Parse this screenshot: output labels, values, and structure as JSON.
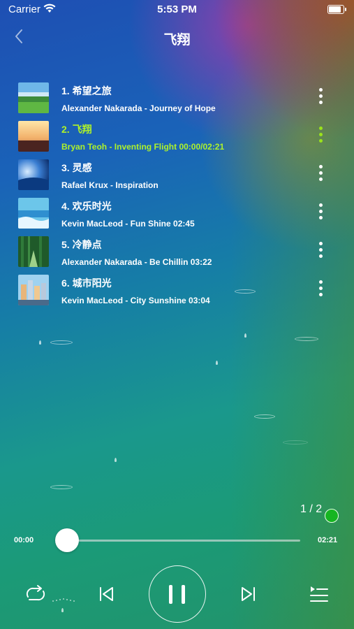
{
  "status_bar": {
    "carrier": "Carrier",
    "time": "5:53 PM",
    "battery_level": 0.95
  },
  "nav": {
    "title": "飞翔",
    "back_icon": "chevron-left-icon"
  },
  "tracks": [
    {
      "title": "1. 希望之旅",
      "subtitle": "Alexander Nakarada - Journey of Hope",
      "active": false
    },
    {
      "title": "2. 飞翔",
      "subtitle": "Bryan Teoh - Inventing Flight 00:00/02:21",
      "active": true
    },
    {
      "title": "3. 灵感",
      "subtitle": "Rafael Krux - Inspiration",
      "active": false
    },
    {
      "title": "4. 欢乐时光",
      "subtitle": "Kevin MacLeod - Fun Shine 02:45",
      "active": false
    },
    {
      "title": "5. 冷静点",
      "subtitle": "Alexander Nakarada - Be Chillin 03:22",
      "active": false
    },
    {
      "title": "6. 城市阳光",
      "subtitle": "Kevin MacLeod - City Sunshine 03:04",
      "active": false
    }
  ],
  "pager": {
    "label": "1 / 2"
  },
  "player": {
    "current_time": "00:00",
    "total_time": "02:21",
    "progress": 0.0
  },
  "controls": {
    "repeat_icon": "repeat-icon",
    "previous_icon": "skip-previous-icon",
    "pause_icon": "pause-icon",
    "next_icon": "skip-next-icon",
    "playlist_icon": "playlist-icon"
  },
  "colors": {
    "active": "#aef22a",
    "accent_green": "#16b521"
  }
}
